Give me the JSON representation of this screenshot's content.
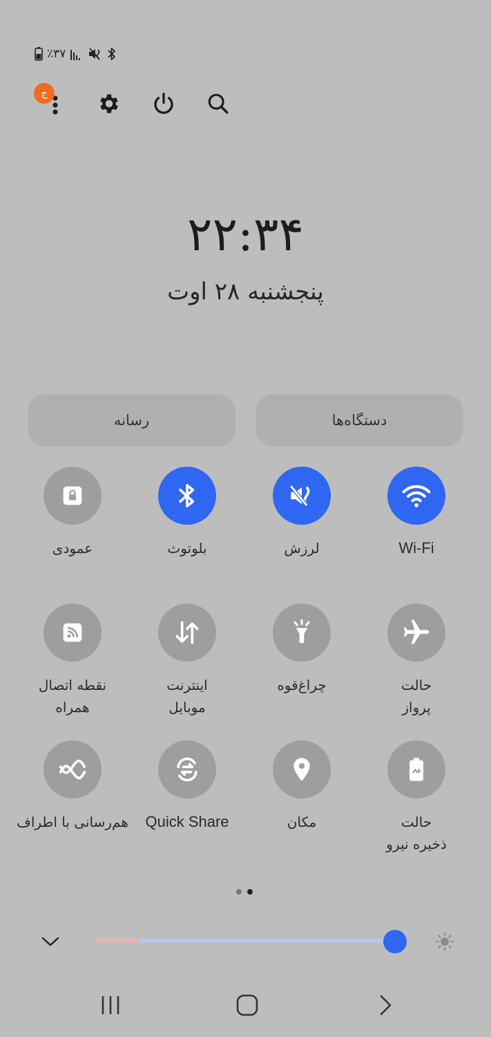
{
  "status_bar": {
    "battery_text": "٪۳۷"
  },
  "top_bar": {
    "avatar_letter": "ج"
  },
  "clock": {
    "time": "۲۲:۳۴",
    "date": "پنجشنبه ۲۸ اوت"
  },
  "pills": {
    "devices_label": "دستگاه‌ها",
    "media_label": "رسانه"
  },
  "tiles": {
    "wifi": "Wi-Fi",
    "vibrate": "لرزش",
    "bluetooth": "بلوتوث",
    "portrait": "عمودی",
    "airplane": "حالت\nپرواز",
    "flashlight": "چراغ‌قوه",
    "mobile_data": "اینترنت\nموبایل",
    "hotspot": "نقطه اتصال\nهمراه",
    "power_saving": "حالت\nذخیره نیرو",
    "location": "مکان",
    "quick_share": "Quick Share",
    "nearby_share": "هم‌رسانی با اطراف"
  },
  "colors": {
    "accent": "#2f66f2",
    "badge": "#f26b21",
    "tile_off": "#9e9e9e",
    "background": "#bdbdbd"
  },
  "brightness": {
    "level": 0.95
  }
}
